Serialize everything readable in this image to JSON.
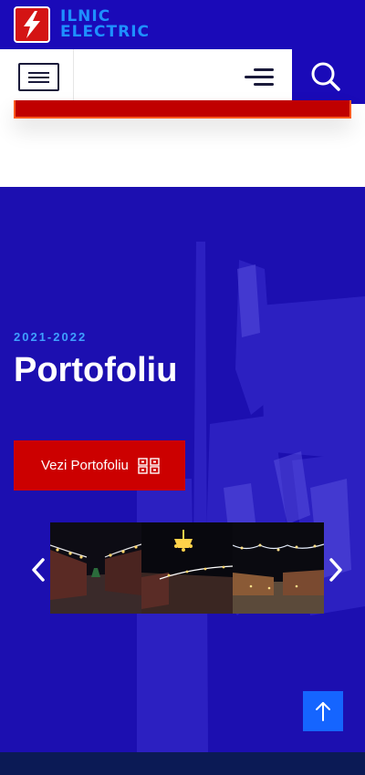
{
  "brand": {
    "line1": "ILNIC",
    "line2": "ELECTRIC",
    "logo_icon": "lightning-bolt-icon",
    "logo_color": "#d41414",
    "text_color": "#1e90ff"
  },
  "nav": {
    "toggle_icon": "hamburger-icon",
    "menu_icon": "menu-lines-icon",
    "search_icon": "search-icon",
    "accent": "#1a0ab8"
  },
  "hero": {
    "eyebrow": "2021-2022",
    "title": "Portofoliu",
    "cta_label": "Vezi Portofoliu",
    "cta_icon": "qr-grid-icon",
    "cta_color": "#cc0000",
    "background": "#1c0fb0"
  },
  "gallery": {
    "prev_icon": "chevron-left-icon",
    "next_icon": "chevron-right-icon",
    "images": [
      {
        "name": "street-lights-night-1"
      },
      {
        "name": "chandelier-decoration-night"
      },
      {
        "name": "festive-garland-plaza-night"
      }
    ]
  },
  "back_to_top": {
    "icon": "arrow-up-icon",
    "color": "#1565ff"
  }
}
